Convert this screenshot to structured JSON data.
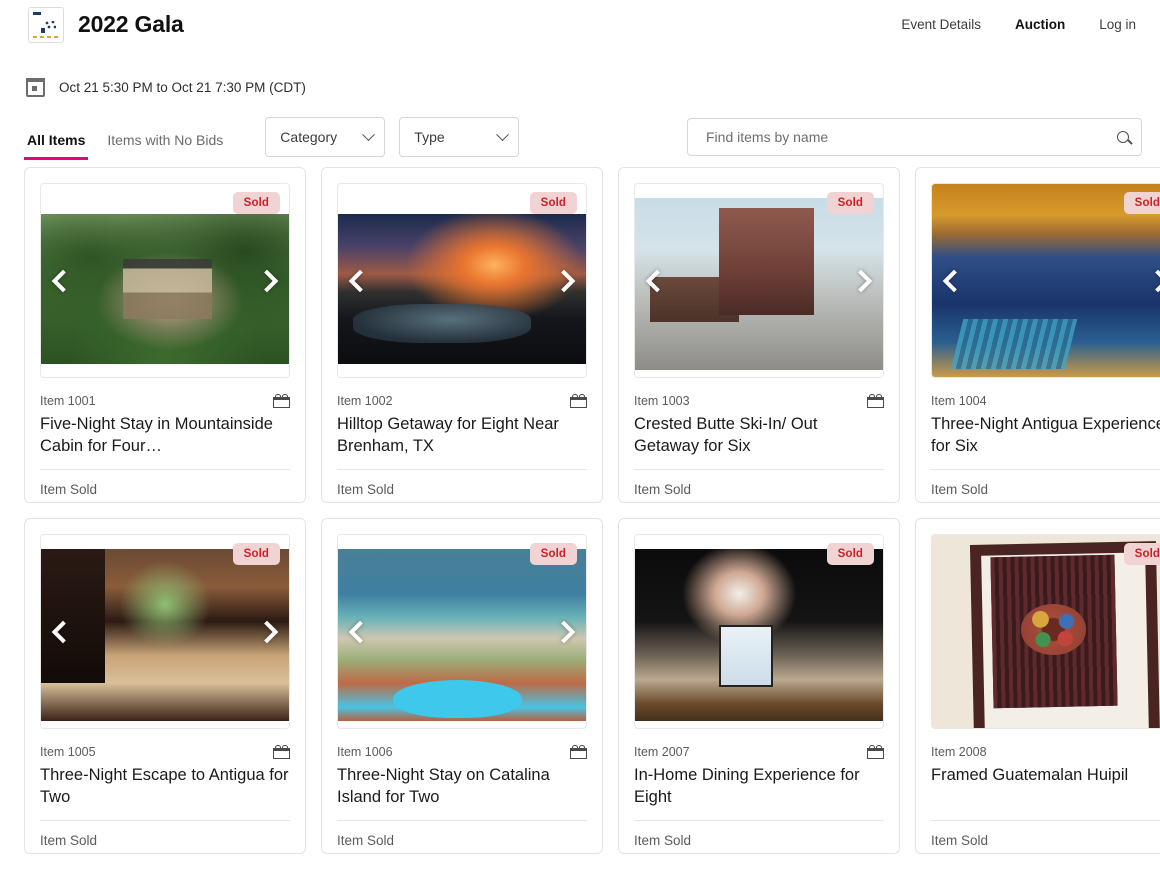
{
  "header": {
    "logo_icon": "event-logo",
    "title": "2022 Gala",
    "nav": [
      {
        "label": "Event Details",
        "active": false
      },
      {
        "label": "Auction",
        "active": true
      },
      {
        "label": "Log in",
        "active": false
      }
    ]
  },
  "date_bar": {
    "icon": "calendar-icon",
    "text": "Oct 21 5:30 PM to Oct 21 7:30 PM (CDT)"
  },
  "filters": {
    "tabs": [
      {
        "label": "All Items",
        "active": true
      },
      {
        "label": "Items with No Bids",
        "active": false
      }
    ],
    "active_tab_underline_color": "#e6007e",
    "selects": [
      {
        "label": "Category",
        "icon": "chevron-down-icon"
      },
      {
        "label": "Type",
        "icon": "chevron-down-icon"
      }
    ],
    "search": {
      "placeholder": "Find items by name",
      "value": "",
      "icon": "search-icon"
    }
  },
  "badges": {
    "sold_label": "Sold",
    "sold_bg": "#f2d3d3",
    "sold_color": "#cc2127"
  },
  "items": [
    {
      "item_number": "Item 1001",
      "title": "Five-Night Stay in Mountainside Cabin for Four…",
      "status": "Item Sold",
      "badge": "Sold",
      "gift_icon": "gift-icon",
      "prev_icon": "chevron-left-icon",
      "next_icon": "chevron-right-icon",
      "has_carousel": true,
      "photo_class": "p1001",
      "photo_fit": "photo"
    },
    {
      "item_number": "Item 1002",
      "title": "Hilltop Getaway for Eight Near Brenham, TX",
      "status": "Item Sold",
      "badge": "Sold",
      "gift_icon": "gift-icon",
      "prev_icon": "chevron-left-icon",
      "next_icon": "chevron-right-icon",
      "has_carousel": true,
      "photo_class": "p1002",
      "photo_fit": "photo"
    },
    {
      "item_number": "Item 1003",
      "title": "Crested Butte Ski-In/ Out Getaway for Six",
      "status": "Item Sold",
      "badge": "Sold",
      "gift_icon": "gift-icon",
      "prev_icon": "chevron-left-icon",
      "next_icon": "chevron-right-icon",
      "has_carousel": true,
      "photo_class": "p1003",
      "photo_fit": "photo wide"
    },
    {
      "item_number": "Item 1004",
      "title": "Three-Night Antigua Experience for Six",
      "status": "Item Sold",
      "badge": "Sold",
      "gift_icon": "gift-icon",
      "prev_icon": "chevron-left-icon",
      "next_icon": "chevron-right-icon",
      "has_carousel": true,
      "photo_class": "p1004",
      "photo_fit": "photo tall"
    },
    {
      "item_number": "Item 1005",
      "title": "Three-Night Escape to Antigua for Two",
      "status": "Item Sold",
      "badge": "Sold",
      "gift_icon": "gift-icon",
      "prev_icon": "chevron-left-icon",
      "next_icon": "chevron-right-icon",
      "has_carousel": true,
      "photo_class": "p1005",
      "photo_fit": "photo wide"
    },
    {
      "item_number": "Item 1006",
      "title": "Three-Night Stay on Catalina Island for Two",
      "status": "Item Sold",
      "badge": "Sold",
      "gift_icon": "gift-icon",
      "prev_icon": "chevron-left-icon",
      "next_icon": "chevron-right-icon",
      "has_carousel": true,
      "photo_class": "p1006",
      "photo_fit": "photo wide"
    },
    {
      "item_number": "Item 2007",
      "title": "In-Home Dining Experience for Eight",
      "status": "Item Sold",
      "badge": "Sold",
      "gift_icon": "gift-icon",
      "prev_icon": "chevron-left-icon",
      "next_icon": "chevron-right-icon",
      "has_carousel": false,
      "photo_class": "p2007",
      "photo_fit": "photo wide"
    },
    {
      "item_number": "Item 2008",
      "title": "Framed Guatemalan Huipil",
      "status": "Item Sold",
      "badge": "Sold",
      "gift_icon": "gift-icon",
      "prev_icon": "chevron-left-icon",
      "next_icon": "chevron-right-icon",
      "has_carousel": false,
      "photo_class": "p2008",
      "photo_fit": "photo tall"
    }
  ]
}
